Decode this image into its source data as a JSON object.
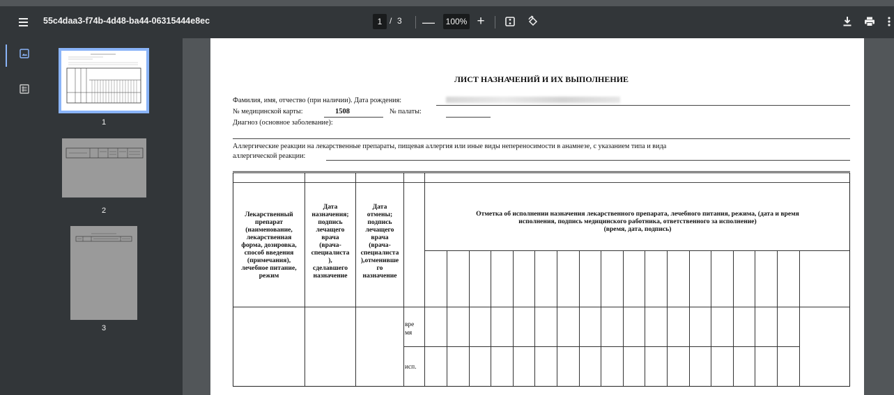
{
  "toolbar": {
    "title": "55c4daa3-f74b-4d48-ba44-06315444e8ec",
    "current_page": "1",
    "page_separator": "/",
    "total_pages": "3",
    "zoom": "100%",
    "zoom_out": "—",
    "zoom_in": "+"
  },
  "sidebar": {
    "thumbnails": [
      {
        "label": "1"
      },
      {
        "label": "2"
      },
      {
        "label": "3"
      }
    ]
  },
  "document": {
    "title": "ЛИСТ НАЗНАЧЕНИЙ И ИХ ВЫПОЛНЕНИЕ",
    "name_label": "Фамилия, имя, отчество (при наличии). Дата рождения:",
    "card_label": "№ медицинской карты:",
    "card_number": "1508",
    "ward_label": "№ палаты:",
    "diagnosis_label": "Диагноз (основное заболевание):",
    "allergy_line1": "Аллергические реакции на лекарственные препараты, пищевая аллергия или иные виды непереносимости в анамнезе, с указанием типа и вида",
    "allergy_line2": "аллергической реакции:"
  },
  "table": {
    "col1_header": [
      "Лекарственный",
      "препарат",
      "(наименование,",
      "лекарственная",
      "форма, дозировка,",
      "способ введения",
      "(примечания),",
      "лечебное питание,",
      "режим"
    ],
    "col2_header": [
      "Дата",
      "назначения;",
      "подпись",
      "лечащего",
      "врача",
      "(врача-",
      "специалиста",
      "),",
      "сделавшего",
      "назначение"
    ],
    "col3_header": [
      "Дата",
      "отмены;",
      "подпись",
      "лечащего",
      "врача",
      "(врача-",
      "специалиста",
      "),отменивше",
      "го",
      "назначение"
    ],
    "mark_header_line1": "Отметка об исполнении назначения лекарственного препарата, лечебного питания, режима, (дата и время",
    "mark_header_line2": "исполнения, подпись медицинского работника, ответственного за исполнение)",
    "mark_header_line3": "(время, дата, подпись)",
    "row_time_label": [
      "вре",
      "мя"
    ],
    "row_exec_label": "исп."
  }
}
